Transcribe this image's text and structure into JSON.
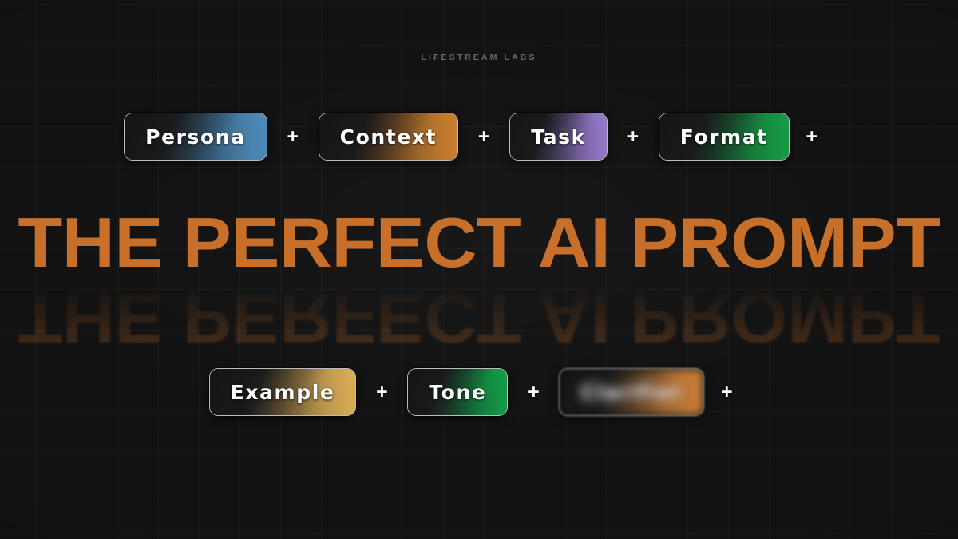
{
  "brand": {
    "label": "LIFESTREAM LABS"
  },
  "headline": {
    "text": "THE PERFECT AI PROMPT",
    "color": "#c8702a"
  },
  "separator": {
    "symbol": "+"
  },
  "rows": {
    "top": [
      {
        "label": "Persona",
        "accent": "#4f8fbf"
      },
      {
        "label": "Context",
        "accent": "#d1832f"
      },
      {
        "label": "Task",
        "accent": "#9b7fd4"
      },
      {
        "label": "Format",
        "accent": "#17a14a"
      }
    ],
    "bottom": [
      {
        "label": "Example",
        "accent": "#e0b259"
      },
      {
        "label": "Tone",
        "accent": "#14a34c"
      },
      {
        "label": "Clarifier",
        "accent": "#d1833a",
        "blurred": true
      }
    ]
  },
  "background": {
    "base_color": "#111111",
    "grid_color": "rgba(255,255,255,0.03)"
  }
}
